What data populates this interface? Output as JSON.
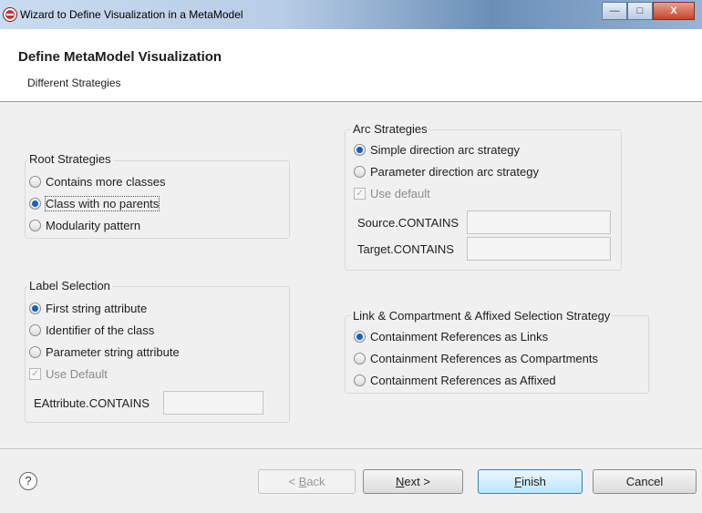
{
  "window": {
    "title": "Wizard to Define Visualization in a MetaModel",
    "controls": {
      "minimize": "—",
      "maximize": "□",
      "close": "X"
    }
  },
  "header": {
    "title": "Define MetaModel Visualization",
    "subtitle": "Different Strategies"
  },
  "root_strategies": {
    "title": "Root Strategies",
    "options": [
      {
        "label": "Contains more classes",
        "selected": false
      },
      {
        "label": "Class with no parents",
        "selected": true
      },
      {
        "label": "Modularity pattern",
        "selected": false
      }
    ]
  },
  "arc_strategies": {
    "title": "Arc Strategies",
    "options": [
      {
        "label": "Simple direction arc strategy",
        "selected": true
      },
      {
        "label": "Parameter direction arc strategy",
        "selected": false
      }
    ],
    "use_default": {
      "label": "Use default",
      "checked": true,
      "check_mark": "✓"
    },
    "source_label": "Source.CONTAINS",
    "source_value": "",
    "target_label": "Target.CONTAINS",
    "target_value": ""
  },
  "label_selection": {
    "title": "Label Selection",
    "options": [
      {
        "label": "First string attribute",
        "selected": true
      },
      {
        "label": "Identifier of the class",
        "selected": false
      },
      {
        "label": "Parameter string attribute",
        "selected": false
      }
    ],
    "use_default": {
      "label": "Use Default",
      "checked": true,
      "check_mark": "✓"
    },
    "eattr_label": "EAttribute.CONTAINS",
    "eattr_value": ""
  },
  "link_strategy": {
    "title": "Link & Compartment & Affixed Selection Strategy",
    "options": [
      {
        "label": "Containment References as Links",
        "selected": true
      },
      {
        "label": "Containment References as Compartments",
        "selected": false
      },
      {
        "label": "Containment References as Affixed",
        "selected": false
      }
    ]
  },
  "footer": {
    "help_glyph": "?",
    "back": {
      "prefix": "< ",
      "mnemonic": "B",
      "rest": "ack"
    },
    "next": {
      "mnemonic": "N",
      "rest": "ext >"
    },
    "finish": {
      "mnemonic": "F",
      "rest": "inish"
    },
    "cancel": "Cancel"
  }
}
